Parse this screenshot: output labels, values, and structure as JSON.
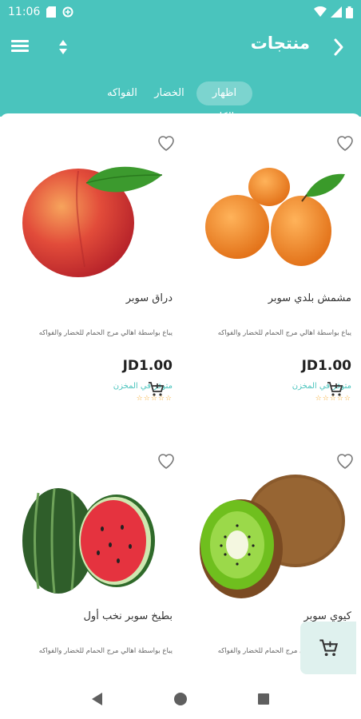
{
  "status_bar": {
    "time": "11:06",
    "icons": [
      "sd-card-icon",
      "data-saver-icon",
      "wifi-icon",
      "signal-icon",
      "battery-icon"
    ]
  },
  "app_bar": {
    "title": "منتجات",
    "icons": {
      "menu": "menu-icon",
      "sort": "sort-icon",
      "back": "chevron-right-icon"
    }
  },
  "filters": [
    {
      "label": "اظهار الكل",
      "active": true
    },
    {
      "label": "الخضار",
      "active": false
    },
    {
      "label": "الفواكه",
      "active": false
    }
  ],
  "products": [
    {
      "name": "مشمش بلدي سوبر",
      "description": "يباع بواسطة اهالي مرج الحمام للخضار والفواكه",
      "price": "JD1.00",
      "stock": "متوفر في المخزن",
      "rating": 0,
      "image": "apricot"
    },
    {
      "name": "دراق سوبر",
      "description": "يباع بواسطة اهالي مرج الحمام للخضار والفواكه",
      "price": "JD1.00",
      "stock": "متوفر في المخزن",
      "rating": 0,
      "image": "peach"
    },
    {
      "name": "كيوي سوبر",
      "description": "يباع بواسطة اهالي مرج الحمام للخضار والفواكه",
      "image": "kiwi"
    },
    {
      "name": "بطيخ سوبر نخب أول",
      "description": "يباع بواسطة اهالي مرج الحمام للخضار والفواكه",
      "image": "watermelon"
    }
  ],
  "colors": {
    "primary": "#4ac4bd",
    "star": "#f5a623"
  },
  "nav_bar": {
    "icons": [
      "back-triangle-icon",
      "home-circle-icon",
      "recents-square-icon"
    ]
  }
}
